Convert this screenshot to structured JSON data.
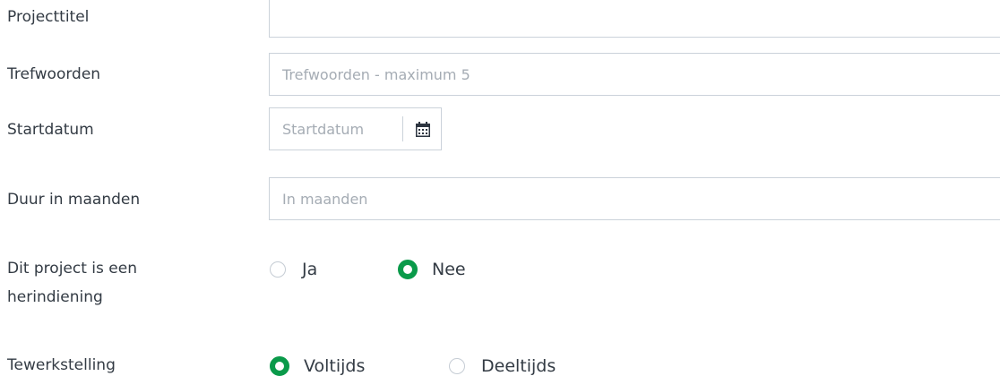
{
  "form": {
    "project_title": {
      "label": "Projecttitel",
      "value": "",
      "placeholder": ""
    },
    "keywords": {
      "label": "Trefwoorden",
      "placeholder": "Trefwoorden - maximum 5"
    },
    "start_date": {
      "label": "Startdatum",
      "placeholder": "Startdatum",
      "icon": "calendar-icon"
    },
    "duration": {
      "label": "Duur in maanden",
      "placeholder": "In maanden"
    },
    "resubmission": {
      "label_line1": "Dit project is een",
      "label_line2": "herindiening",
      "options": [
        "Ja",
        "Nee"
      ],
      "selected": "Nee"
    },
    "employment": {
      "label": "Tewerkstelling",
      "options": [
        "Voltijds",
        "Deeltijds"
      ],
      "selected": "Voltijds"
    }
  },
  "colors": {
    "accent": "#0a9a4a",
    "border": "#cbd2da",
    "text": "#333b44",
    "placeholder": "#a5acb4"
  }
}
